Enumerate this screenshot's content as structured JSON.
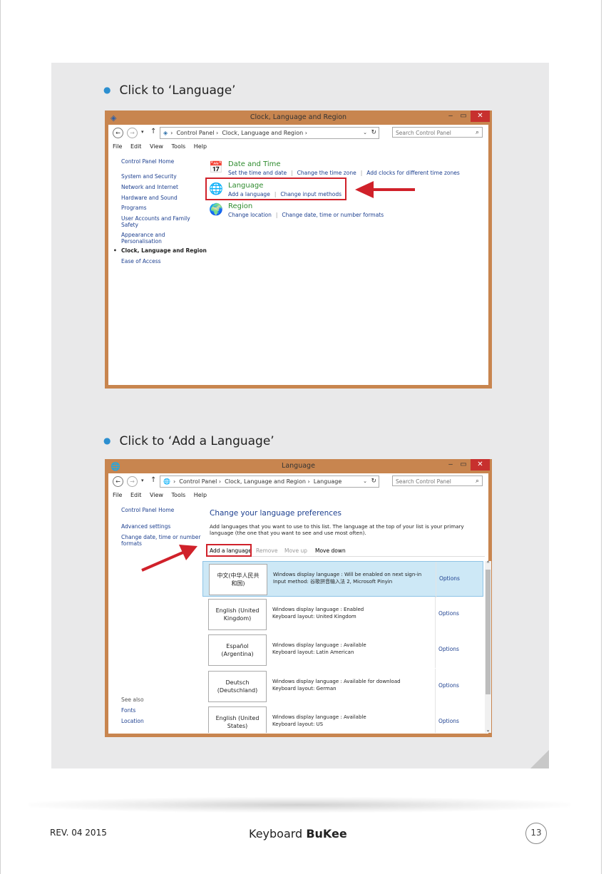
{
  "instructions": {
    "step1": "Click to ‘Language’",
    "step2": "Click to ‘Add a Language’"
  },
  "window1": {
    "title": "Clock, Language and Region",
    "breadcrumb": [
      "Control Panel",
      "Clock, Language and Region"
    ],
    "search_placeholder": "Search Control Panel",
    "menu": [
      "File",
      "Edit",
      "View",
      "Tools",
      "Help"
    ],
    "nav": {
      "home": "Control Panel Home",
      "items": [
        "System and Security",
        "Network and Internet",
        "Hardware and Sound",
        "Programs",
        "User Accounts and Family",
        "Safety",
        "Appearance and",
        "Personalisation",
        "Clock, Language and Region",
        "Ease of Access"
      ]
    },
    "categories": [
      {
        "title": "Date and Time",
        "links": [
          "Set the time and date",
          "Change the time zone",
          "Add clocks for different time zones"
        ]
      },
      {
        "title": "Language",
        "links": [
          "Add a language",
          "Change input methods"
        ]
      },
      {
        "title": "Region",
        "links": [
          "Change location",
          "Change date, time or number formats"
        ]
      }
    ]
  },
  "window2": {
    "title": "Language",
    "breadcrumb": [
      "Control Panel",
      "Clock, Language and Region",
      "Language"
    ],
    "search_placeholder": "Search Control Panel",
    "menu": [
      "File",
      "Edit",
      "View",
      "Tools",
      "Help"
    ],
    "nav": {
      "home": "Control Panel Home",
      "advanced": "Advanced settings",
      "formats_line1": "Change date, time or number",
      "formats_line2": "formats",
      "see_also": "See also",
      "fonts": "Fonts",
      "location": "Location"
    },
    "heading": "Change your language preferences",
    "description": "Add languages that you want to use to this list. The language at the top of your list is your primary language (the one that you want to see and use most often).",
    "toolbar": {
      "add": "Add a language",
      "remove": "Remove",
      "move_up": "Move up",
      "move_down": "Move down"
    },
    "languages": [
      {
        "name1": "中文(中华人民共",
        "name2": "和国)",
        "line1": "Windows display language : Will be enabled on next sign-in",
        "line2": "Input method: 谷歌拼音输入法 2, Microsoft Pinyin",
        "options": "Options"
      },
      {
        "name1": "English (United",
        "name2": "Kingdom)",
        "line1": "Windows display language : Enabled",
        "line2": "Keyboard layout: United Kingdom",
        "options": "Options"
      },
      {
        "name1": "Español",
        "name2": "(Argentina)",
        "line1": "Windows display language : Available",
        "line2": "Keyboard layout: Latin American",
        "options": "Options"
      },
      {
        "name1": "Deutsch",
        "name2": "(Deutschland)",
        "line1": "Windows display language : Available for download",
        "line2": "Keyboard layout: German",
        "options": "Options"
      },
      {
        "name1": "English (United",
        "name2": "States)",
        "line1": "Windows display language : Available",
        "line2": "Keyboard layout: US",
        "options": "Options"
      }
    ]
  },
  "footer": {
    "revision": "REV. 04 2015",
    "brand_prefix": "Keyboard",
    "brand_name": "BuKee",
    "page_number": "13"
  },
  "colors": {
    "window_frame": "#c8854f",
    "highlight": "#d0212a",
    "bullet": "#2c8fd0",
    "link": "#1c3f8f",
    "category_title": "#2e8b2e"
  }
}
